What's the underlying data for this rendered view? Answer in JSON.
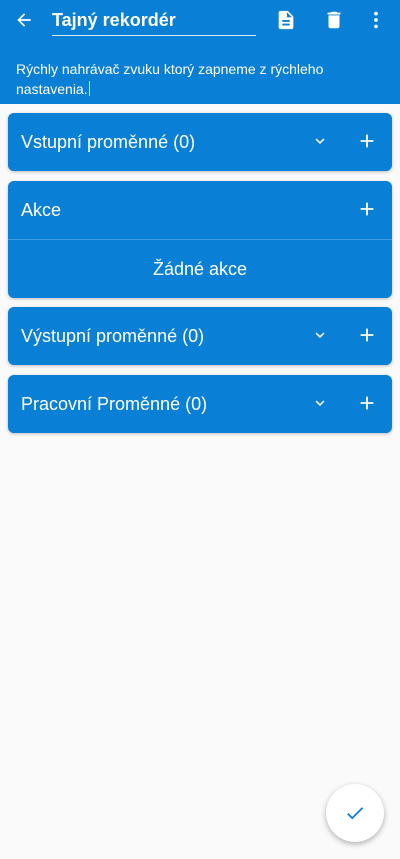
{
  "header": {
    "title": "Tajný rekordér",
    "description": "Rýchly nahrávač zvuku ktorý zapneme z rýchleho nastavenia."
  },
  "icons": {
    "back": "arrow-left-icon",
    "document": "document-icon",
    "delete": "trash-icon",
    "more": "more-vertical-icon",
    "expand": "chevron-down-icon",
    "add": "plus-icon",
    "confirm": "check-icon"
  },
  "sections": {
    "input_vars": {
      "label": "Vstupní proměnné (0)"
    },
    "actions": {
      "label": "Akce",
      "empty_text": "Žádné akce"
    },
    "output_vars": {
      "label": "Výstupní proměnné (0)"
    },
    "working_vars": {
      "label": "Pracovní Proměnné (0)"
    }
  },
  "colors": {
    "primary": "#0a7fd6",
    "background": "#fafafa",
    "fab_icon": "#0a7fd6"
  }
}
